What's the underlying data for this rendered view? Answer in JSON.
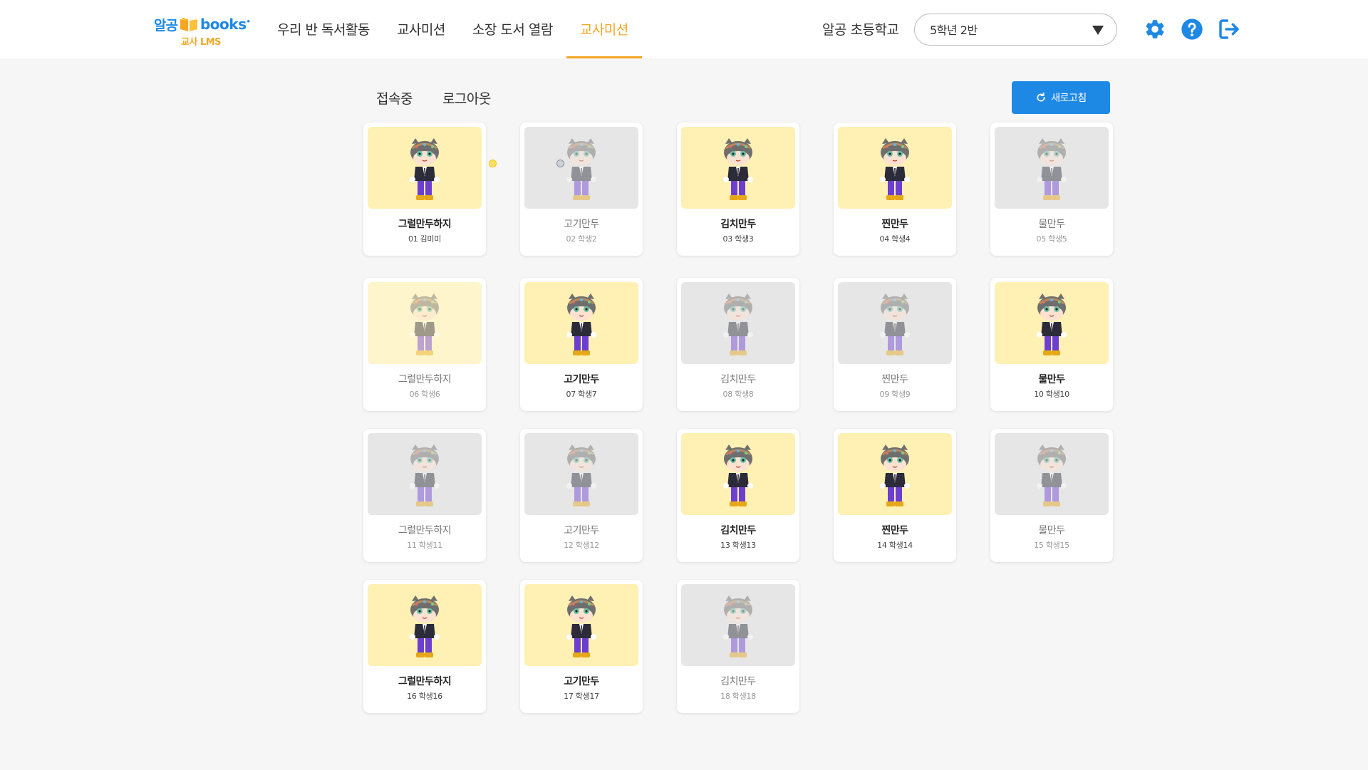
{
  "logo": {
    "brand": "알공",
    "books": "books",
    "mark": "•",
    "sub": "교사 LMS"
  },
  "nav": {
    "items": [
      {
        "label": "우리 반 독서활동"
      },
      {
        "label": "교사미션"
      },
      {
        "label": "소장 도서 열람"
      },
      {
        "label": "교사미션"
      }
    ],
    "active_index": 3
  },
  "school": "알공 초등학교",
  "class_select": {
    "value": "5학년 2반"
  },
  "header_icons": [
    "gear-icon",
    "help-icon",
    "logout-icon"
  ],
  "tabs": [
    {
      "label": "접속중"
    },
    {
      "label": "로그아웃"
    }
  ],
  "refresh": {
    "label": "새로고침",
    "icon": "refresh-icon"
  },
  "colors": {
    "accent": "#1e88e5",
    "active_nav": "#f5a623",
    "online_bg": "#fff0b3",
    "offline_bg": "#e6e6e6"
  },
  "students": [
    {
      "nickname": "그럴만두하지",
      "info": "01 김미미",
      "status": "online"
    },
    {
      "nickname": "고기만두",
      "info": "02 학생2",
      "status": "offline"
    },
    {
      "nickname": "김치만두",
      "info": "03 학생3",
      "status": "online"
    },
    {
      "nickname": "찐만두",
      "info": "04 학생4",
      "status": "online"
    },
    {
      "nickname": "물만두",
      "info": "05 학생5",
      "status": "offline"
    },
    {
      "nickname": "그럴만두하지",
      "info": "06 학생6",
      "status": "fade"
    },
    {
      "nickname": "고기만두",
      "info": "07 학생7",
      "status": "online"
    },
    {
      "nickname": "김치만두",
      "info": "08 학생8",
      "status": "offline"
    },
    {
      "nickname": "찐만두",
      "info": "09 학생9",
      "status": "offline"
    },
    {
      "nickname": "물만두",
      "info": "10 학생10",
      "status": "online"
    },
    {
      "nickname": "그럴만두하지",
      "info": "11 학생11",
      "status": "offline"
    },
    {
      "nickname": "고기만두",
      "info": "12 학생12",
      "status": "offline"
    },
    {
      "nickname": "김치만두",
      "info": "13 학생13",
      "status": "online"
    },
    {
      "nickname": "찐만두",
      "info": "14 학생14",
      "status": "online"
    },
    {
      "nickname": "물만두",
      "info": "15 학생15",
      "status": "offline"
    },
    {
      "nickname": "그럴만두하지",
      "info": "16 학생16",
      "status": "online"
    },
    {
      "nickname": "고기만두",
      "info": "17 학생17",
      "status": "online"
    },
    {
      "nickname": "김치만두",
      "info": "18 학생18",
      "status": "offline"
    }
  ]
}
